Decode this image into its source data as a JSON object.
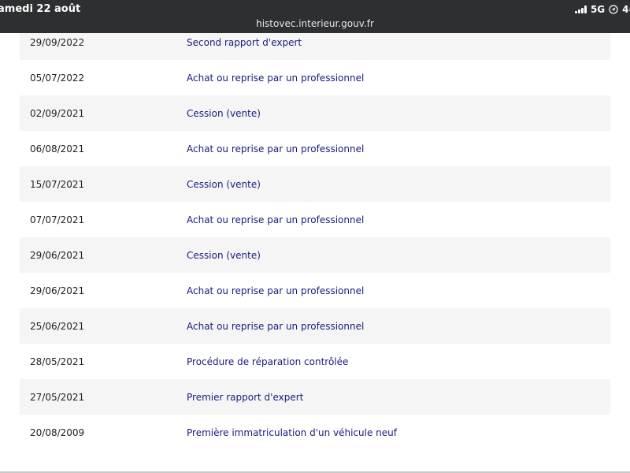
{
  "status_bar": {
    "time": "amedi 22 août",
    "network": "5G",
    "battery": "4("
  },
  "browser": {
    "url": "histovec.interieur.gouv.fr"
  },
  "history": {
    "rows": [
      {
        "date": "29/09/2022",
        "event": "Second rapport d'expert"
      },
      {
        "date": "05/07/2022",
        "event": "Achat ou reprise par un professionnel"
      },
      {
        "date": "02/09/2021",
        "event": "Cession (vente)"
      },
      {
        "date": "06/08/2021",
        "event": "Achat ou reprise par un professionnel"
      },
      {
        "date": "15/07/2021",
        "event": "Cession (vente)"
      },
      {
        "date": "07/07/2021",
        "event": "Achat ou reprise par un professionnel"
      },
      {
        "date": "29/06/2021",
        "event": "Cession (vente)"
      },
      {
        "date": "29/06/2021",
        "event": "Achat ou reprise par un professionnel"
      },
      {
        "date": "25/06/2021",
        "event": "Achat ou reprise par un professionnel"
      },
      {
        "date": "28/05/2021",
        "event": "Procédure de réparation contrôlée"
      },
      {
        "date": "27/05/2021",
        "event": "Premier rapport d'expert"
      },
      {
        "date": "20/08/2009",
        "event": "Première immatriculation d'un véhicule neuf"
      }
    ]
  },
  "colors": {
    "status_bar_bg": "#2d2f30",
    "row_shade": "#f5f5f6",
    "event_text": "#1a1b7e",
    "date_text": "#222222"
  },
  "icons": {
    "signal": "signal-icon",
    "location": "location-arrow-icon"
  }
}
